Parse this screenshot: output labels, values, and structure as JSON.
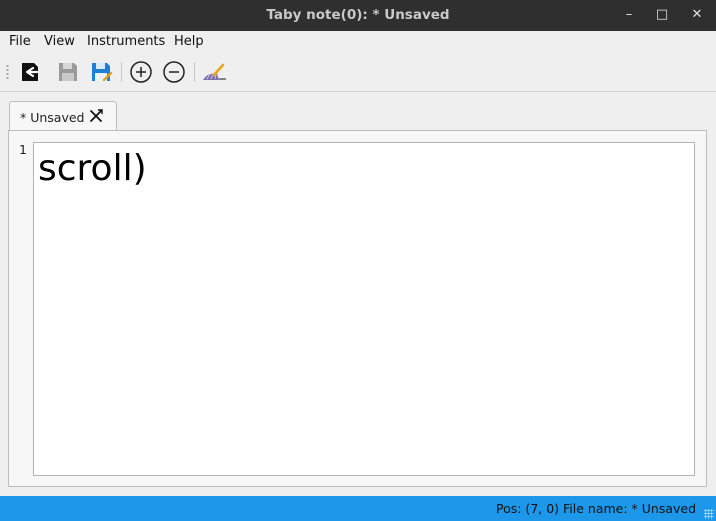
{
  "window": {
    "title": "Taby note(0): * Unsaved",
    "minimize_glyph": "–",
    "maximize_glyph": "□",
    "close_glyph": "✕"
  },
  "menu": {
    "items": [
      {
        "label": "File"
      },
      {
        "label": "View"
      },
      {
        "label": "Instruments"
      },
      {
        "label": "Help"
      }
    ]
  },
  "toolbar": {
    "buttons": [
      {
        "icon": "exit-icon"
      },
      {
        "icon": "save-icon",
        "enabled": false
      },
      {
        "icon": "save-as-icon"
      },
      {
        "icon": "zoom-in-icon"
      },
      {
        "icon": "zoom-out-icon"
      },
      {
        "icon": "clean-brush-icon"
      }
    ]
  },
  "tabs": [
    {
      "label": "* Unsaved",
      "active": true
    }
  ],
  "editor": {
    "line_numbers": [
      "1"
    ],
    "content": "scroll)"
  },
  "status": {
    "pos": "Pos: (7, 0)",
    "file": "File name: * Unsaved"
  },
  "colors": {
    "titlebar": "#2f2f2f",
    "statusbar": "#1c97ea",
    "save_as_accent": "#1f7fd6"
  }
}
